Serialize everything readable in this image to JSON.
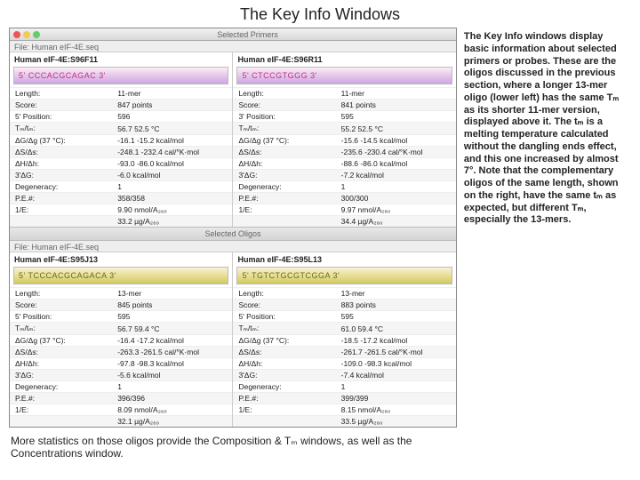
{
  "page_title": "The Key Info Windows",
  "explanation_right": "The Key Info windows display basic information about selected primers or probes. These are the oligos discussed in the previous section, where a longer 13-mer oligo (lower left) has the same Tₘ as its shorter 11-mer version, displayed above it. The tₘ is a melting temperature calculated without the dangling ends effect, and this one increased by almost 7°. Note that the complementary oligos of the same length, shown on the right, have the same tₘ as expected, but different Tₘ, especially the 13-mers.",
  "footer_note": "More statistics on those oligos provide the Composition & Tₘ windows, as well as the Concentrations window.",
  "top": {
    "header": "Selected Primers",
    "file": "File: Human eIF-4E.seq",
    "left": {
      "name": "Human eIF-4E:S96F11",
      "seq": "5' CCCACGCAGAC 3'",
      "rows": [
        [
          "Length:",
          "11-mer"
        ],
        [
          "Score:",
          "847 points"
        ],
        [
          "5' Position:",
          "596"
        ],
        [
          "Tₘ/tₘ:",
          "56.7           52.5 °C"
        ],
        [
          "ΔG/Δg (37 °C):",
          "-16.1          -15.2 kcal/mol"
        ],
        [
          "ΔS/Δs:",
          "-248.1        -232.4 cal/°K·mol"
        ],
        [
          "ΔH/Δh:",
          "-93.0          -86.0 kcal/mol"
        ],
        [
          "3'ΔG:",
          "                 -6.0 kcal/mol"
        ],
        [
          "Degeneracy:",
          "1"
        ],
        [
          "P.E.#:",
          "358/358"
        ],
        [
          "1/E:",
          "9.90 nmol/A₂₆₀"
        ],
        [
          "",
          "33.2 µg/A₂₆₀"
        ]
      ]
    },
    "right": {
      "name": "Human eIF-4E:S96R11",
      "seq": "5' CTCCGTGGG 3'",
      "rows": [
        [
          "Length:",
          "11-mer"
        ],
        [
          "Score:",
          "841 points"
        ],
        [
          "3' Position:",
          "595"
        ],
        [
          "Tₘ/tₘ:",
          "55.2           52.5 °C"
        ],
        [
          "ΔG/Δg (37 °C):",
          "-15.6          -14.5 kcal/mol"
        ],
        [
          "ΔS/Δs:",
          "-235.6        -230.4 cal/°K·mol"
        ],
        [
          "ΔH/Δh:",
          "-88.6          -86.0 kcal/mol"
        ],
        [
          "3'ΔG:",
          "                 -7.2 kcal/mol"
        ],
        [
          "Degeneracy:",
          "1"
        ],
        [
          "P.E.#:",
          "300/300"
        ],
        [
          "1/E:",
          "9.97 nmol/A₂₆₀"
        ],
        [
          "",
          "34.4 µg/A₂₆₀"
        ]
      ]
    }
  },
  "bot": {
    "header": "Selected Oligos",
    "file": "File: Human eIF-4E.seq",
    "left": {
      "name": "Human eIF-4E:S95J13",
      "seq": "5' TCCCACGCAGACA 3'",
      "rows": [
        [
          "Length:",
          "13-mer"
        ],
        [
          "Score:",
          "845 points"
        ],
        [
          "5' Position:",
          "595"
        ],
        [
          "Tₘ/tₘ:",
          "56.7           59.4 °C"
        ],
        [
          "ΔG/Δg (37 °C):",
          "-16.4          -17.2 kcal/mol"
        ],
        [
          "ΔS/Δs:",
          "-263.3        -261.5 cal/°K·mol"
        ],
        [
          "ΔH/Δh:",
          "-97.8          -98.3 kcal/mol"
        ],
        [
          "3'ΔG:",
          "                 -5.6 kcal/mol"
        ],
        [
          "Degeneracy:",
          "1"
        ],
        [
          "P.E.#:",
          "396/396"
        ],
        [
          "1/E:",
          "8.09 nmol/A₂₆₀"
        ],
        [
          "",
          "32.1 µg/A₂₆₀"
        ]
      ]
    },
    "right": {
      "name": "Human eIF-4E:S95L13",
      "seq": "5' TGTCTGCGTCGGA 3'",
      "rows": [
        [
          "Length:",
          "13-mer"
        ],
        [
          "Score:",
          "883 points"
        ],
        [
          "5' Position:",
          "595"
        ],
        [
          "Tₘ/tₘ:",
          "61.0           59.4 °C"
        ],
        [
          "ΔG/Δg (37 °C):",
          "-18.5          -17.2 kcal/mol"
        ],
        [
          "ΔS/Δs:",
          "-261.7        -261.5 cal/°K·mol"
        ],
        [
          "ΔH/Δh:",
          "-109.0        -98.3 kcal/mol"
        ],
        [
          "3'ΔG:",
          "                 -7.4 kcal/mol"
        ],
        [
          "Degeneracy:",
          "1"
        ],
        [
          "P.E.#:",
          "399/399"
        ],
        [
          "1/E:",
          "8.15 nmol/A₂₆₀"
        ],
        [
          "",
          "33.5 µg/A₂₆₀"
        ]
      ]
    }
  }
}
